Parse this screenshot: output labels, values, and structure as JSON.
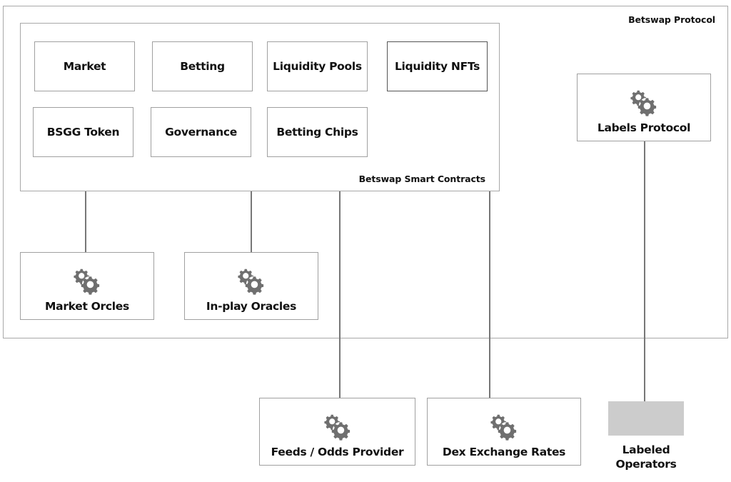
{
  "protocol": {
    "label": "Betswap Protocol"
  },
  "smart_contracts": {
    "label": "Betswap Smart Contracts",
    "modules": [
      "Market",
      "Betting",
      "Liquidity Pools",
      "Liquidity NFTs",
      "BSGG Token",
      "Governance",
      "Betting Chips"
    ]
  },
  "services": {
    "labels_protocol": "Labels Protocol",
    "market_oracles": "Market Orcles",
    "inplay_oracles": "In-play Oracles",
    "feeds": "Feeds / Odds Provider",
    "dex": "Dex Exchange Rates"
  },
  "labeled_operators": {
    "line1": "Labeled",
    "line2": "Operators"
  },
  "icons": {
    "service": "gears-icon"
  },
  "colors": {
    "gear": "#6f6f6f",
    "operator_fill": "#cccccc",
    "border": "#a0a0a0"
  }
}
